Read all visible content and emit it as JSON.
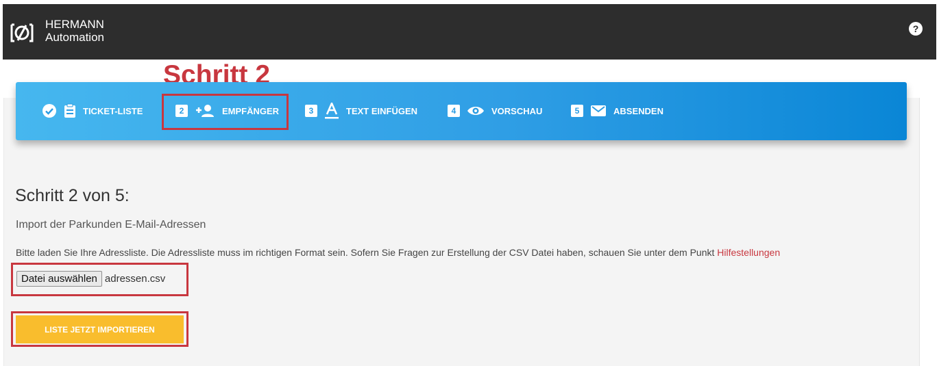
{
  "header": {
    "brand_line1": "HERMANN",
    "brand_line2": "Automation",
    "help_label": "?"
  },
  "annotation": {
    "label": "Schritt 2"
  },
  "stepper": {
    "steps": [
      {
        "number": "",
        "label": "TICKET-LISTE",
        "icon": "clipboard-icon",
        "status": "done"
      },
      {
        "number": "2",
        "label": "EMPFÄNGER",
        "icon": "add-user-icon",
        "status": "active"
      },
      {
        "number": "3",
        "label": "TEXT EINFÜGEN",
        "icon": "text-format-icon",
        "status": "pending"
      },
      {
        "number": "4",
        "label": "VORSCHAU",
        "icon": "eye-icon",
        "status": "pending"
      },
      {
        "number": "5",
        "label": "ABSENDEN",
        "icon": "mail-icon",
        "status": "pending"
      }
    ]
  },
  "main": {
    "heading": "Schritt 2 von 5:",
    "subheading": "Import der Parkunden E-Mail-Adressen",
    "instructions": "Bitte laden Sie Ihre Adressliste. Die Adressliste muss im richtigen Format sein. Sofern Sie Fragen zur Erstellung der CSV Datei haben, schauen Sie unter dem Punkt ",
    "help_link": "Hilfestellungen",
    "file_button": "Datei auswählen",
    "file_name": "adressen.csv",
    "import_button": "LISTE JETZT IMPORTIEREN"
  },
  "colors": {
    "header_bg": "#2d2d2d",
    "stepper_start": "#46b7ef",
    "stepper_end": "#0a86d6",
    "highlight_red": "#c8373f",
    "import_button": "#f9bd2d"
  }
}
